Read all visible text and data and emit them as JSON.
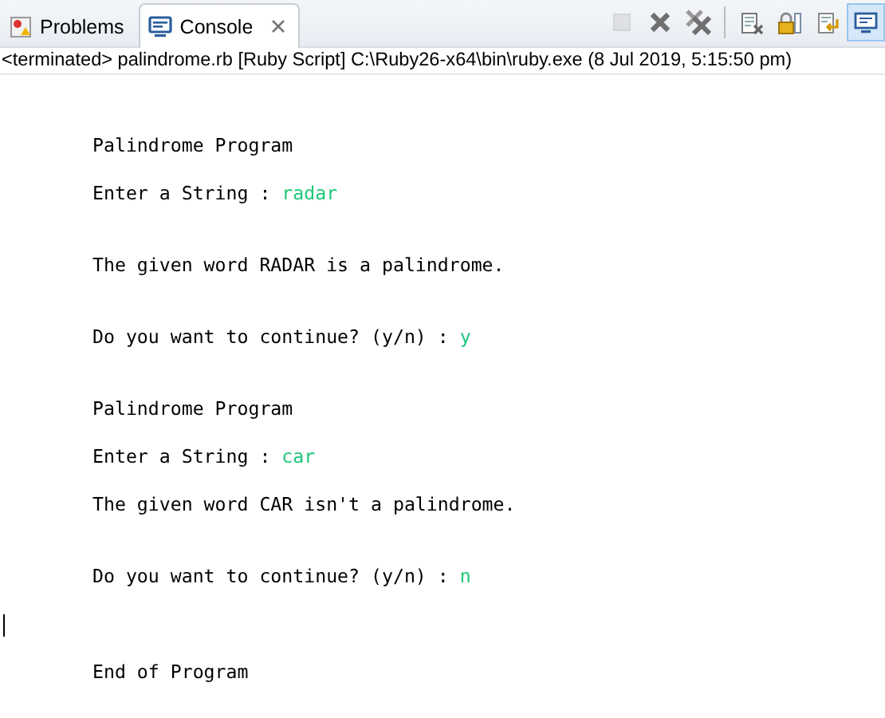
{
  "tabs": [
    {
      "label": "Problems",
      "selected": false
    },
    {
      "label": "Console",
      "selected": true
    }
  ],
  "toolbar": [
    {
      "kind": "terminate",
      "disabled": true,
      "pressed": false
    },
    {
      "kind": "remove",
      "disabled": false,
      "pressed": false
    },
    {
      "kind": "remove-all",
      "disabled": false,
      "pressed": false
    },
    {
      "kind": "clear",
      "disabled": false,
      "pressed": false
    },
    {
      "kind": "scroll-lock",
      "disabled": false,
      "pressed": false
    },
    {
      "kind": "word-wrap",
      "disabled": false,
      "pressed": false
    },
    {
      "kind": "display",
      "disabled": false,
      "pressed": true
    }
  ],
  "status": "<terminated> palindrome.rb [Ruby Script] C:\\Ruby26-x64\\bin\\ruby.exe (8 Jul 2019, 5:15:50 pm)",
  "console": [
    {
      "kind": "blank"
    },
    {
      "kind": "blank"
    },
    {
      "kind": "line",
      "text": "Palindrome Program"
    },
    {
      "kind": "blank"
    },
    {
      "kind": "line",
      "text": "Enter a String : ",
      "input": "radar"
    },
    {
      "kind": "blank"
    },
    {
      "kind": "blank"
    },
    {
      "kind": "line",
      "text": "The given word RADAR is a palindrome."
    },
    {
      "kind": "blank"
    },
    {
      "kind": "blank"
    },
    {
      "kind": "line",
      "text": "Do you want to continue? (y/n) : ",
      "input": "y"
    },
    {
      "kind": "blank"
    },
    {
      "kind": "blank"
    },
    {
      "kind": "line",
      "text": "Palindrome Program"
    },
    {
      "kind": "blank"
    },
    {
      "kind": "line",
      "text": "Enter a String : ",
      "input": "car"
    },
    {
      "kind": "blank"
    },
    {
      "kind": "line",
      "text": "The given word CAR isn't a palindrome."
    },
    {
      "kind": "blank"
    },
    {
      "kind": "blank"
    },
    {
      "kind": "line",
      "text": "Do you want to continue? (y/n) : ",
      "input": "n"
    },
    {
      "kind": "blank"
    },
    {
      "kind": "cursor"
    },
    {
      "kind": "blank"
    },
    {
      "kind": "line",
      "text": "End of Program"
    }
  ]
}
